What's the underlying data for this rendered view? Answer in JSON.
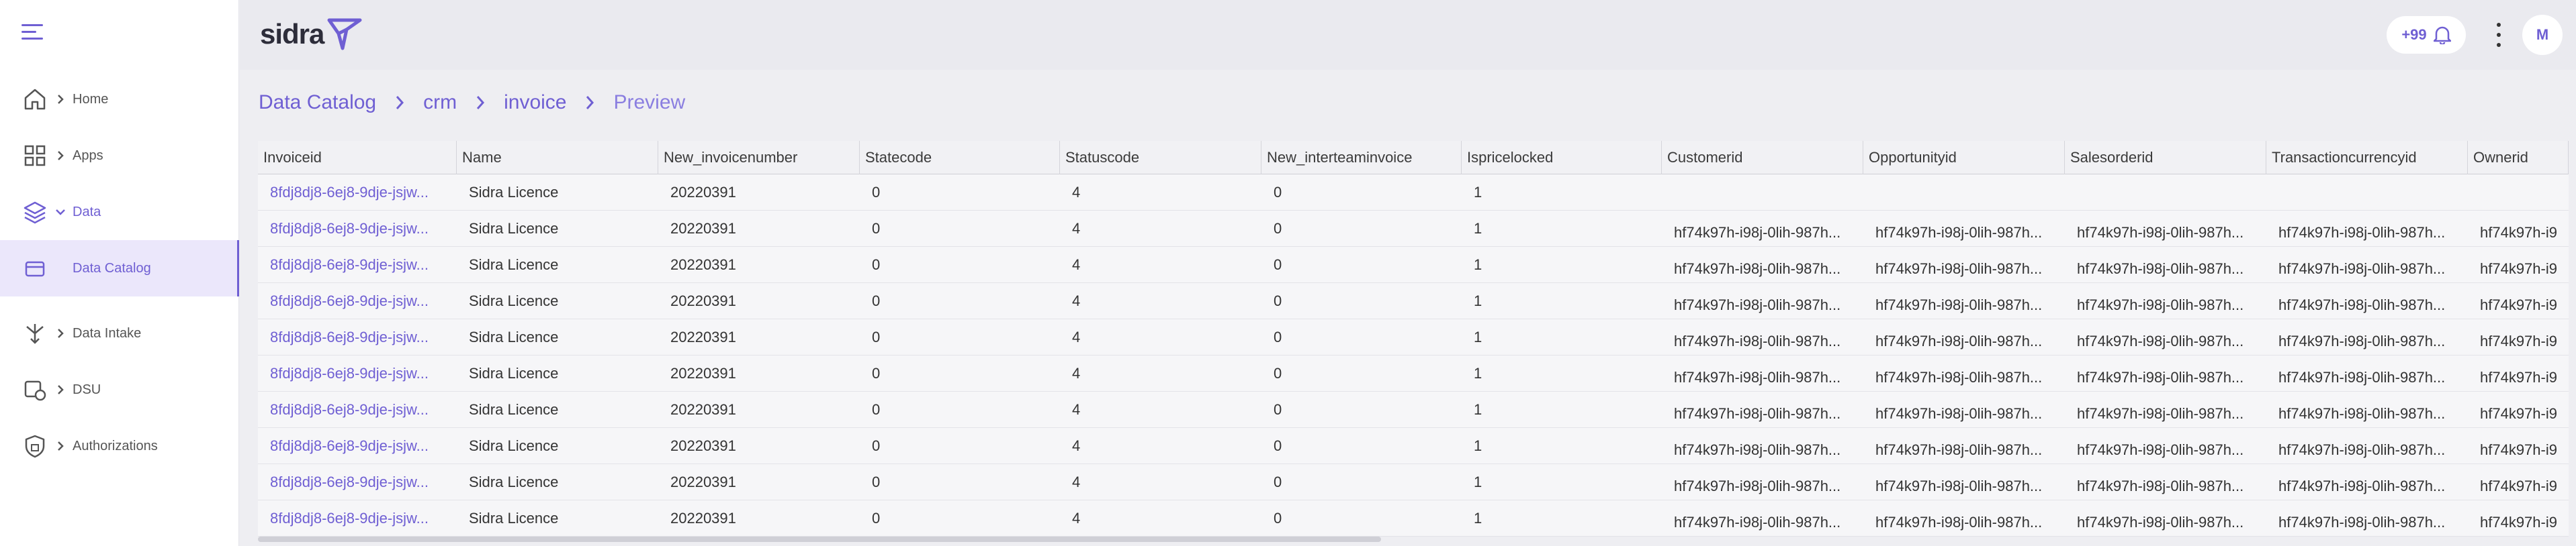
{
  "app": {
    "logo_text": "sidra",
    "avatar_initial": "M",
    "notifications_count": "+99"
  },
  "sidebar": {
    "items": [
      {
        "label": "Home",
        "icon": "home-icon",
        "has_chevron": true,
        "chevron": "right"
      },
      {
        "label": "Apps",
        "icon": "grid-icon",
        "has_chevron": true,
        "chevron": "right"
      },
      {
        "label": "Data",
        "icon": "layers-icon",
        "has_chevron": true,
        "chevron": "down"
      },
      {
        "label": "Data Catalog",
        "icon": "catalog-icon",
        "has_chevron": false,
        "active": true
      },
      {
        "label": "Data Intake",
        "icon": "intake-icon",
        "has_chevron": true,
        "chevron": "right"
      },
      {
        "label": "DSU",
        "icon": "dsu-icon",
        "has_chevron": true,
        "chevron": "right"
      },
      {
        "label": "Authorizations",
        "icon": "shield-icon",
        "has_chevron": true,
        "chevron": "right"
      }
    ]
  },
  "breadcrumb": [
    "Data Catalog",
    "crm",
    "invoice",
    "Preview"
  ],
  "table": {
    "columns": [
      "Invoiceid",
      "Name",
      "New_invoicenumber",
      "Statecode",
      "Statuscode",
      "New_interteaminvoice",
      "Ispricelocked",
      "Customerid",
      "Opportunityid",
      "Salesorderid",
      "Transactioncurrencyid",
      "Ownerid"
    ],
    "rows": [
      [
        "8fdj8dj8-6ej8-9dje-jsjw...",
        "Sidra Licence",
        "20220391",
        "0",
        "4",
        "0",
        "1",
        "",
        "",
        "",
        "",
        ""
      ],
      [
        "8fdj8dj8-6ej8-9dje-jsjw...",
        "Sidra Licence",
        "20220391",
        "0",
        "4",
        "0",
        "1",
        "hf74k97h-i98j-0lih-987h...",
        "hf74k97h-i98j-0lih-987h...",
        "hf74k97h-i98j-0lih-987h...",
        "hf74k97h-i98j-0lih-987h...",
        "hf74k97h-i9"
      ],
      [
        "8fdj8dj8-6ej8-9dje-jsjw...",
        "Sidra Licence",
        "20220391",
        "0",
        "4",
        "0",
        "1",
        "hf74k97h-i98j-0lih-987h...",
        "hf74k97h-i98j-0lih-987h...",
        "hf74k97h-i98j-0lih-987h...",
        "hf74k97h-i98j-0lih-987h...",
        "hf74k97h-i9"
      ],
      [
        "8fdj8dj8-6ej8-9dje-jsjw...",
        "Sidra Licence",
        "20220391",
        "0",
        "4",
        "0",
        "1",
        "hf74k97h-i98j-0lih-987h...",
        "hf74k97h-i98j-0lih-987h...",
        "hf74k97h-i98j-0lih-987h...",
        "hf74k97h-i98j-0lih-987h...",
        "hf74k97h-i9"
      ],
      [
        "8fdj8dj8-6ej8-9dje-jsjw...",
        "Sidra Licence",
        "20220391",
        "0",
        "4",
        "0",
        "1",
        "hf74k97h-i98j-0lih-987h...",
        "hf74k97h-i98j-0lih-987h...",
        "hf74k97h-i98j-0lih-987h...",
        "hf74k97h-i98j-0lih-987h...",
        "hf74k97h-i9"
      ],
      [
        "8fdj8dj8-6ej8-9dje-jsjw...",
        "Sidra Licence",
        "20220391",
        "0",
        "4",
        "0",
        "1",
        "hf74k97h-i98j-0lih-987h...",
        "hf74k97h-i98j-0lih-987h...",
        "hf74k97h-i98j-0lih-987h...",
        "hf74k97h-i98j-0lih-987h...",
        "hf74k97h-i9"
      ],
      [
        "8fdj8dj8-6ej8-9dje-jsjw...",
        "Sidra Licence",
        "20220391",
        "0",
        "4",
        "0",
        "1",
        "hf74k97h-i98j-0lih-987h...",
        "hf74k97h-i98j-0lih-987h...",
        "hf74k97h-i98j-0lih-987h...",
        "hf74k97h-i98j-0lih-987h...",
        "hf74k97h-i9"
      ],
      [
        "8fdj8dj8-6ej8-9dje-jsjw...",
        "Sidra Licence",
        "20220391",
        "0",
        "4",
        "0",
        "1",
        "hf74k97h-i98j-0lih-987h...",
        "hf74k97h-i98j-0lih-987h...",
        "hf74k97h-i98j-0lih-987h...",
        "hf74k97h-i98j-0lih-987h...",
        "hf74k97h-i9"
      ],
      [
        "8fdj8dj8-6ej8-9dje-jsjw...",
        "Sidra Licence",
        "20220391",
        "0",
        "4",
        "0",
        "1",
        "hf74k97h-i98j-0lih-987h...",
        "hf74k97h-i98j-0lih-987h...",
        "hf74k97h-i98j-0lih-987h...",
        "hf74k97h-i98j-0lih-987h...",
        "hf74k97h-i9"
      ],
      [
        "8fdj8dj8-6ej8-9dje-jsjw...",
        "Sidra Licence",
        "20220391",
        "0",
        "4",
        "0",
        "1",
        "hf74k97h-i98j-0lih-987h...",
        "hf74k97h-i98j-0lih-987h...",
        "hf74k97h-i98j-0lih-987h...",
        "hf74k97h-i98j-0lih-987h...",
        "hf74k97h-i9"
      ]
    ]
  },
  "colors": {
    "accent": "#6f5fd3",
    "background": "#eeeef2",
    "sidebar": "#ffffff"
  }
}
